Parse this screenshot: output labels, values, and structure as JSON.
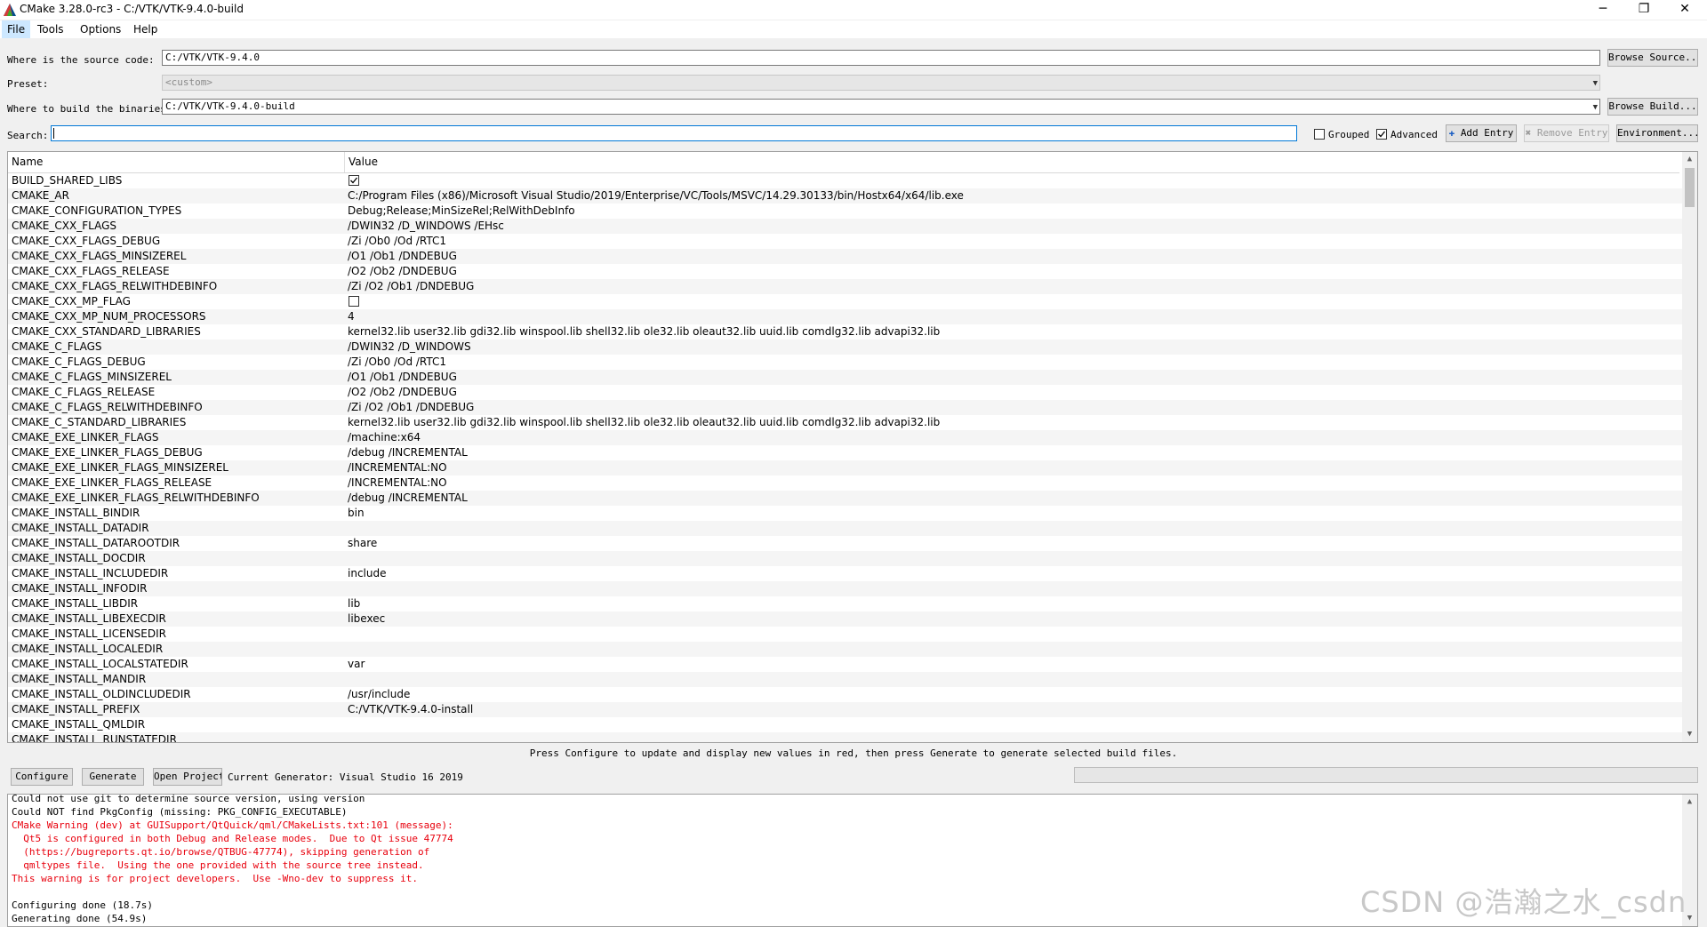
{
  "window": {
    "title": "CMake 3.28.0-rc3 - C:/VTK/VTK-9.4.0-build",
    "minimize": "─",
    "maximize": "❐",
    "close": "✕"
  },
  "menu": [
    "File",
    "Tools",
    "Options",
    "Help"
  ],
  "source": {
    "label": "Where is the source code:",
    "value": "C:/VTK/VTK-9.4.0",
    "button": "Browse Source..."
  },
  "preset": {
    "label": "Preset:",
    "value": "<custom>"
  },
  "build": {
    "label": "Where to build the binaries:",
    "value": "C:/VTK/VTK-9.4.0-build",
    "button": "Browse Build..."
  },
  "search": {
    "label": "Search:",
    "value": ""
  },
  "options": {
    "grouped_label": "Grouped",
    "grouped_checked": false,
    "advanced_label": "Advanced",
    "advanced_checked": true,
    "add_entry": "Add Entry",
    "remove_entry": "Remove Entry",
    "environment": "Environment..."
  },
  "table": {
    "columns": [
      "Name",
      "Value"
    ],
    "rows": [
      {
        "name": "BUILD_SHARED_LIBS",
        "type": "bool",
        "checked": true,
        "value": ""
      },
      {
        "name": "CMAKE_AR",
        "value": "C:/Program Files (x86)/Microsoft Visual Studio/2019/Enterprise/VC/Tools/MSVC/14.29.30133/bin/Hostx64/x64/lib.exe"
      },
      {
        "name": "CMAKE_CONFIGURATION_TYPES",
        "value": "Debug;Release;MinSizeRel;RelWithDebInfo"
      },
      {
        "name": "CMAKE_CXX_FLAGS",
        "value": "/DWIN32 /D_WINDOWS /EHsc"
      },
      {
        "name": "CMAKE_CXX_FLAGS_DEBUG",
        "value": "/Zi /Ob0 /Od /RTC1"
      },
      {
        "name": "CMAKE_CXX_FLAGS_MINSIZEREL",
        "value": "/O1 /Ob1 /DNDEBUG"
      },
      {
        "name": "CMAKE_CXX_FLAGS_RELEASE",
        "value": "/O2 /Ob2 /DNDEBUG"
      },
      {
        "name": "CMAKE_CXX_FLAGS_RELWITHDEBINFO",
        "value": "/Zi /O2 /Ob1 /DNDEBUG"
      },
      {
        "name": "CMAKE_CXX_MP_FLAG",
        "type": "bool",
        "checked": false,
        "value": ""
      },
      {
        "name": "CMAKE_CXX_MP_NUM_PROCESSORS",
        "value": "4"
      },
      {
        "name": "CMAKE_CXX_STANDARD_LIBRARIES",
        "value": "kernel32.lib user32.lib gdi32.lib winspool.lib shell32.lib ole32.lib oleaut32.lib uuid.lib comdlg32.lib advapi32.lib"
      },
      {
        "name": "CMAKE_C_FLAGS",
        "value": "/DWIN32 /D_WINDOWS"
      },
      {
        "name": "CMAKE_C_FLAGS_DEBUG",
        "value": "/Zi /Ob0 /Od /RTC1"
      },
      {
        "name": "CMAKE_C_FLAGS_MINSIZEREL",
        "value": "/O1 /Ob1 /DNDEBUG"
      },
      {
        "name": "CMAKE_C_FLAGS_RELEASE",
        "value": "/O2 /Ob2 /DNDEBUG"
      },
      {
        "name": "CMAKE_C_FLAGS_RELWITHDEBINFO",
        "value": "/Zi /O2 /Ob1 /DNDEBUG"
      },
      {
        "name": "CMAKE_C_STANDARD_LIBRARIES",
        "value": "kernel32.lib user32.lib gdi32.lib winspool.lib shell32.lib ole32.lib oleaut32.lib uuid.lib comdlg32.lib advapi32.lib"
      },
      {
        "name": "CMAKE_EXE_LINKER_FLAGS",
        "value": "/machine:x64"
      },
      {
        "name": "CMAKE_EXE_LINKER_FLAGS_DEBUG",
        "value": "/debug /INCREMENTAL"
      },
      {
        "name": "CMAKE_EXE_LINKER_FLAGS_MINSIZEREL",
        "value": "/INCREMENTAL:NO"
      },
      {
        "name": "CMAKE_EXE_LINKER_FLAGS_RELEASE",
        "value": "/INCREMENTAL:NO"
      },
      {
        "name": "CMAKE_EXE_LINKER_FLAGS_RELWITHDEBINFO",
        "value": "/debug /INCREMENTAL"
      },
      {
        "name": "CMAKE_INSTALL_BINDIR",
        "value": "bin"
      },
      {
        "name": "CMAKE_INSTALL_DATADIR",
        "value": ""
      },
      {
        "name": "CMAKE_INSTALL_DATAROOTDIR",
        "value": "share"
      },
      {
        "name": "CMAKE_INSTALL_DOCDIR",
        "value": ""
      },
      {
        "name": "CMAKE_INSTALL_INCLUDEDIR",
        "value": "include"
      },
      {
        "name": "CMAKE_INSTALL_INFODIR",
        "value": ""
      },
      {
        "name": "CMAKE_INSTALL_LIBDIR",
        "value": "lib"
      },
      {
        "name": "CMAKE_INSTALL_LIBEXECDIR",
        "value": "libexec"
      },
      {
        "name": "CMAKE_INSTALL_LICENSEDIR",
        "value": ""
      },
      {
        "name": "CMAKE_INSTALL_LOCALEDIR",
        "value": ""
      },
      {
        "name": "CMAKE_INSTALL_LOCALSTATEDIR",
        "value": "var"
      },
      {
        "name": "CMAKE_INSTALL_MANDIR",
        "value": ""
      },
      {
        "name": "CMAKE_INSTALL_OLDINCLUDEDIR",
        "value": "/usr/include"
      },
      {
        "name": "CMAKE_INSTALL_PREFIX",
        "value": "C:/VTK/VTK-9.4.0-install"
      },
      {
        "name": "CMAKE_INSTALL_QMLDIR",
        "value": ""
      },
      {
        "name": "CMAKE_INSTALL_RUNSTATEDIR",
        "value": ""
      }
    ]
  },
  "hint": "Press Configure to update and display new values in red, then press Generate to generate selected build files.",
  "actions": {
    "configure": "Configure",
    "generate": "Generate",
    "open_project": "Open Project",
    "generator": "Current Generator: Visual Studio 16 2019"
  },
  "log": [
    {
      "text": "Could not use git to determine source version, using version",
      "warn": false
    },
    {
      "text": "Could NOT find PkgConfig (missing: PKG_CONFIG_EXECUTABLE)",
      "warn": false
    },
    {
      "text": "CMake Warning (dev) at GUISupport/QtQuick/qml/CMakeLists.txt:101 (message):",
      "warn": true
    },
    {
      "text": "  Qt5 is configured in both Debug and Release modes.  Due to Qt issue 47774",
      "warn": true
    },
    {
      "text": "  (https://bugreports.qt.io/browse/QTBUG-47774), skipping generation of",
      "warn": true
    },
    {
      "text": "  qmltypes file.  Using the one provided with the source tree instead.",
      "warn": true
    },
    {
      "text": "This warning is for project developers.  Use -Wno-dev to suppress it.",
      "warn": true
    },
    {
      "text": "",
      "warn": false
    },
    {
      "text": "Configuring done (18.7s)",
      "warn": false
    },
    {
      "text": "Generating done (54.9s)",
      "warn": false
    }
  ],
  "watermark": "CSDN @浩瀚之水_csdn",
  "colors": {
    "warning": "#e8000d",
    "accent": "#0078d7",
    "menu_highlight": "#cde8ff"
  }
}
